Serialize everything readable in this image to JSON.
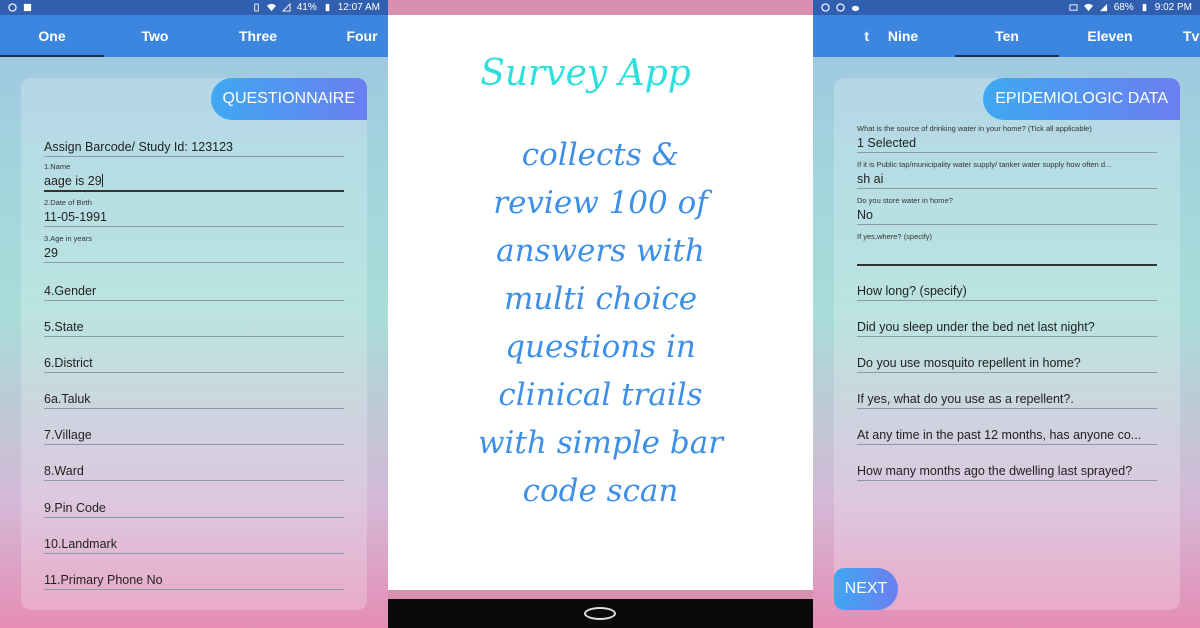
{
  "left_phone": {
    "status": {
      "battery": "41%",
      "time": "12:07 AM"
    },
    "tabs": [
      "One",
      "Two",
      "Three",
      "Four"
    ],
    "card_title": "QUESTIONNAIRE",
    "fields": [
      {
        "label": "",
        "value": "Assign Barcode/ Study Id:  123123"
      },
      {
        "label": "1.Name",
        "value": "aage is 29"
      },
      {
        "label": "2.Date of Birth",
        "value": "11-05-1991"
      },
      {
        "label": "3.Age in years",
        "value": "29"
      },
      {
        "label": "",
        "value": "4.Gender"
      },
      {
        "label": "",
        "value": "5.State"
      },
      {
        "label": "",
        "value": "6.District"
      },
      {
        "label": "",
        "value": "6a.Taluk"
      },
      {
        "label": "",
        "value": "7.Village"
      },
      {
        "label": "",
        "value": "8.Ward"
      },
      {
        "label": "",
        "value": "9.Pin Code"
      },
      {
        "label": "",
        "value": "10.Landmark"
      },
      {
        "label": "",
        "value": "11.Primary Phone No"
      }
    ]
  },
  "center": {
    "title": "Survey App",
    "lines": [
      "collects &",
      "review 100 of",
      "answers with",
      "multi choice",
      "questions in",
      "clinical trails",
      "with simple bar",
      "code scan"
    ]
  },
  "right_phone": {
    "status": {
      "battery": "68%",
      "time": "9:02 PM"
    },
    "tabs": [
      "t",
      "Nine",
      "Ten",
      "Eleven",
      "Tv"
    ],
    "card_title": "EPIDEMIOLOGIC DATA",
    "fields": [
      {
        "label": "What is the source of drinking water in your home? (Tick all applicable)",
        "value": "1 Selected"
      },
      {
        "label": "If it is Public tap/municipality water supply/ tanker water supply how often d...",
        "value": "sh ai"
      },
      {
        "label": "Do you store water in home?",
        "value": "No"
      },
      {
        "label": "If yes,where? (specify)",
        "value": ""
      },
      {
        "label": "",
        "value": "How long? (specify)"
      },
      {
        "label": "",
        "value": "Did you sleep under the bed net last night?"
      },
      {
        "label": "",
        "value": "Do you use mosquito repellent in home?"
      },
      {
        "label": "",
        "value": "If yes, what do you use as a repellent?."
      },
      {
        "label": "",
        "value": "At any time in the past 12 months, has anyone co..."
      },
      {
        "label": "",
        "value": "How many months ago the dwelling last sprayed?"
      }
    ],
    "next_label": "NEXT"
  }
}
